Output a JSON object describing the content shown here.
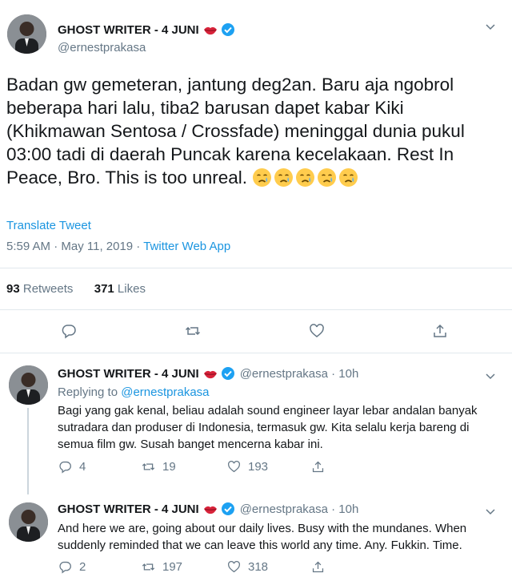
{
  "main_tweet": {
    "display_name": "GHOST WRITER - 4 JUNI",
    "handle": "@ernestprakasa",
    "text": "Badan gw gemeteran, jantung  deg2an. Baru aja ngobrol beberapa hari lalu, tiba2 barusan dapet kabar Kiki (Khikmawan Sentosa / Crossfade) meninggal dunia pukul 03:00 tadi di daerah Puncak karena kecelakaan. Rest In Peace, Bro. This is too unreal. ",
    "emoji_count": 5,
    "translate_label": "Translate Tweet",
    "timestamp": "5:59 AM · May 11, 2019 · ",
    "app": "Twitter Web App",
    "retweets_count": "93",
    "retweets_label": " Retweets",
    "likes_count": "371",
    "likes_label": " Likes"
  },
  "replies": [
    {
      "display_name": "GHOST WRITER - 4 JUNI",
      "meta": "@ernestprakasa · 10h",
      "replying_label": "Replying to ",
      "replying_mention": "@ernestprakasa",
      "text": "Bagi yang gak kenal, beliau adalah sound engineer layar lebar andalan banyak sutradara dan produser di Indonesia, termasuk gw. Kita selalu kerja bareng di semua film gw. Susah banget mencerna kabar ini.",
      "reply_count": "4",
      "retweet_count": "19",
      "like_count": "193"
    },
    {
      "display_name": "GHOST WRITER - 4 JUNI",
      "meta": "@ernestprakasa · 10h",
      "text": "And here we are, going about our daily lives. Busy with the mundanes. When suddenly reminded that we can leave this world any time. Any. Fukkin. Time.",
      "reply_count": "2",
      "retweet_count": "197",
      "like_count": "318"
    }
  ],
  "colors": {
    "accent": "#1b95e0",
    "muted": "#657786",
    "divider": "#e1e8ed"
  },
  "icons": [
    "lips-emoji",
    "verified-icon",
    "chevron-down-icon",
    "crying-emoji",
    "reply-icon",
    "retweet-icon",
    "like-icon",
    "share-icon"
  ]
}
